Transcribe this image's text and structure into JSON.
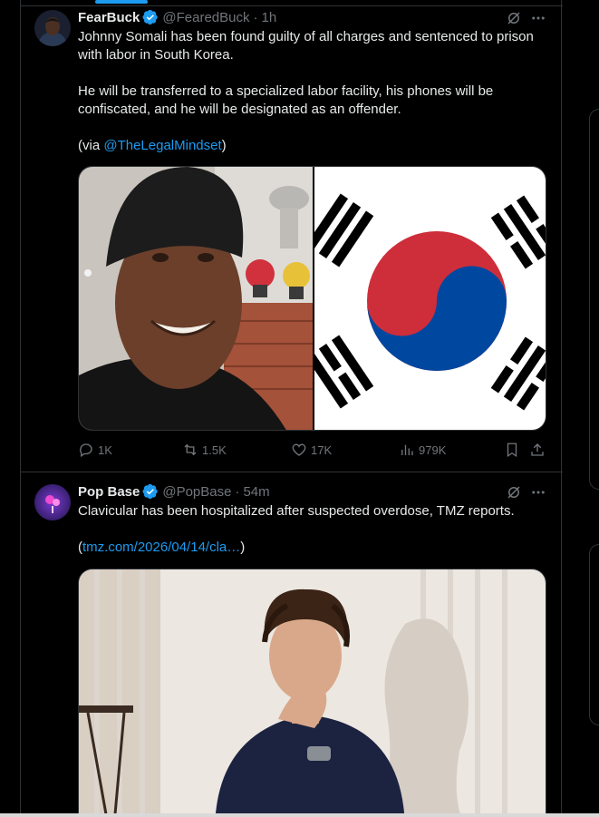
{
  "colors": {
    "accent": "#1d9bf0",
    "text": "#e7e9ea",
    "muted": "#71767b",
    "border": "#2f3336"
  },
  "tweets": [
    {
      "name": "FearBuck",
      "handle": "@FearedBuck",
      "time": "1h",
      "body_1": "Johnny Somali has been found guilty of all charges and sentenced to prison with labor in South Korea.",
      "body_2": "He will be transferred to a specialized labor facility, his phones will be confiscated, and he will be designated as an offender.",
      "via_prefix": "(via ",
      "via_link": "@TheLegalMindset",
      "via_suffix": ")",
      "replies": "1K",
      "reposts": "1.5K",
      "likes": "17K",
      "views": "979K"
    },
    {
      "name": "Pop Base",
      "handle": "@PopBase",
      "time": "54m",
      "body_1": "Clavicular has been hospitalized after suspected overdose, TMZ reports.",
      "link_prefix": "(",
      "link_text": "tmz.com/2026/04/14/cla…",
      "link_suffix": ")"
    }
  ],
  "icons": [
    "verified-badge-icon",
    "grok-icon",
    "more-icon",
    "reply-icon",
    "repost-icon",
    "like-icon",
    "views-icon",
    "bookmark-icon",
    "share-icon"
  ]
}
